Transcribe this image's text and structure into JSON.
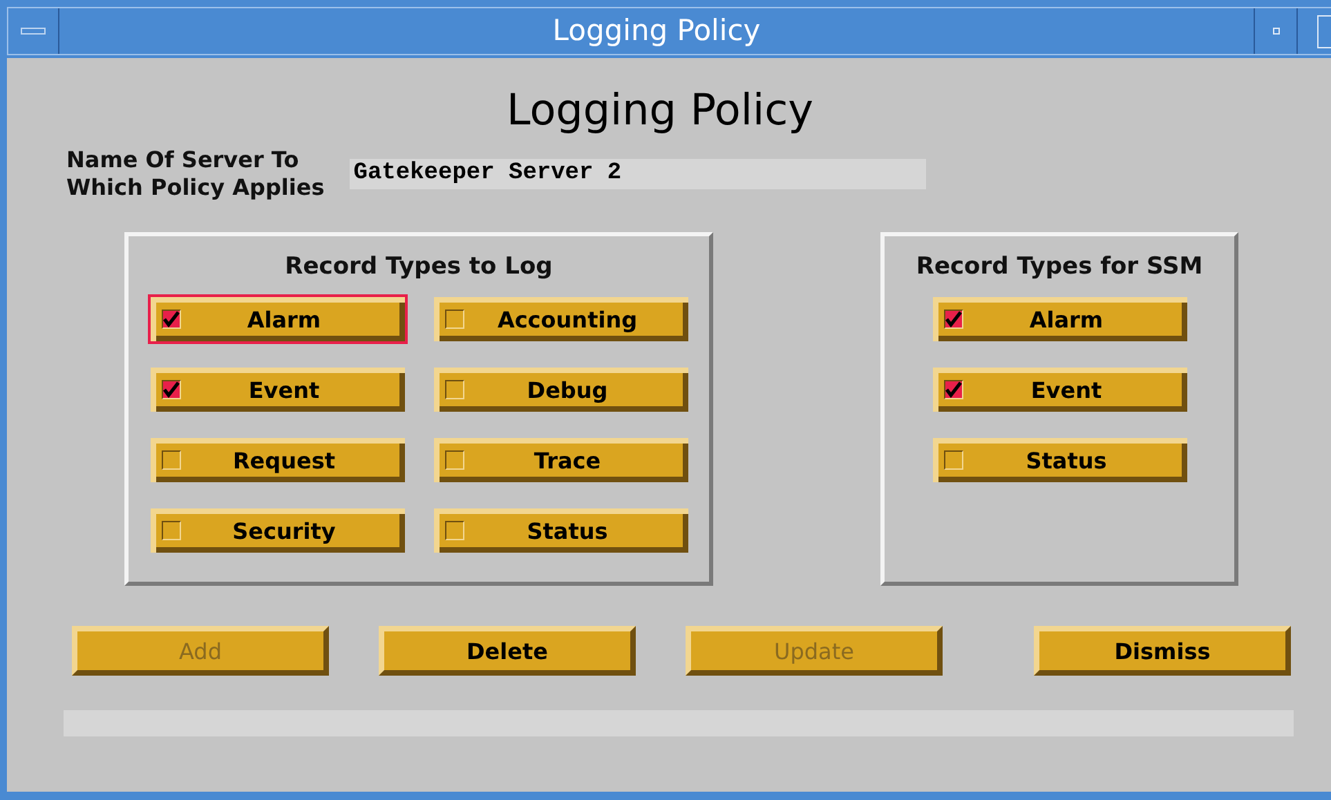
{
  "window": {
    "title": "Logging Policy"
  },
  "heading": "Logging Policy",
  "server": {
    "label": "Name Of Server To\nWhich Policy Applies",
    "value": "Gatekeeper Server 2"
  },
  "log_group": {
    "title": "Record Types to Log",
    "items": [
      {
        "label": "Alarm",
        "checked": true,
        "focused": true
      },
      {
        "label": "Accounting",
        "checked": false,
        "focused": false
      },
      {
        "label": "Event",
        "checked": true,
        "focused": false
      },
      {
        "label": "Debug",
        "checked": false,
        "focused": false
      },
      {
        "label": "Request",
        "checked": false,
        "focused": false
      },
      {
        "label": "Trace",
        "checked": false,
        "focused": false
      },
      {
        "label": "Security",
        "checked": false,
        "focused": false
      },
      {
        "label": "Status",
        "checked": false,
        "focused": false
      }
    ]
  },
  "ssm_group": {
    "title": "Record Types for SSM",
    "items": [
      {
        "label": "Alarm",
        "checked": true,
        "focused": false
      },
      {
        "label": "Event",
        "checked": true,
        "focused": false
      },
      {
        "label": "Status",
        "checked": false,
        "focused": false
      }
    ]
  },
  "buttons": [
    {
      "label": "Add",
      "disabled": true
    },
    {
      "label": "Delete",
      "disabled": false
    },
    {
      "label": "Update",
      "disabled": true
    },
    {
      "label": "Dismiss",
      "disabled": false
    }
  ]
}
